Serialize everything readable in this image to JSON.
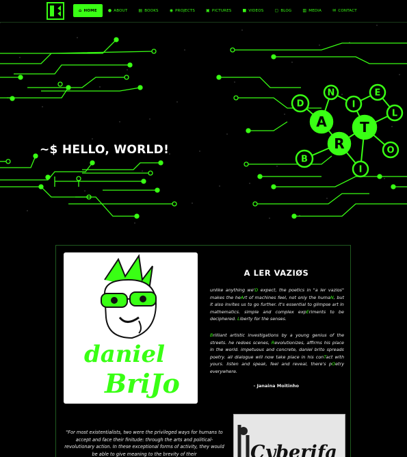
{
  "nav": {
    "items": [
      {
        "label": "HOME",
        "icon": "home-icon"
      },
      {
        "label": "ABOUT",
        "icon": "user-icon"
      },
      {
        "label": "BOOKS",
        "icon": "book-icon"
      },
      {
        "label": "PROJECTS",
        "icon": "lightbulb-icon"
      },
      {
        "label": "PICTURES",
        "icon": "image-icon"
      },
      {
        "label": "VIDEOS",
        "icon": "video-icon"
      },
      {
        "label": "BLOG",
        "icon": "blog-icon"
      },
      {
        "label": "MEDIA",
        "icon": "newspaper-icon"
      },
      {
        "label": "CONTACT",
        "icon": "envelope-icon"
      }
    ],
    "active": "HOME"
  },
  "hero": {
    "heading": "~$ HELLO, WORLD!",
    "circuit_letters": [
      "N",
      "E",
      "D",
      "I",
      "L",
      "A",
      "T",
      "R",
      "O",
      "B",
      "I"
    ]
  },
  "about": {
    "title": "A LER VAZIØS",
    "paragraph1": "unlike anything we'D expect, the poetics in \"a ler vazios\" makes the heArt of machines feel, not only the humaN, but it also invites us to go further. it's essential to glimpse art in mathematics. simple and complex expEriments to be deciphered. Liberty for the senses.",
    "paragraph2": "Brilliant artistic investigations by a young genius of the streets. he redoes scenes, Revolutionizes, affirms his place in the world. impetuous and concrete, daniel brito spreads poetry. all dialogue will now take place in his conTact with yours. listen and speak, feel and reveal, there's pOetry everywhere.",
    "signature": "- Janaina Moitinho",
    "quote": "\"For most existentialists, two were the privileged ways for humans to accept and face their finitude: through the arts and political-revolutionary action. In these exceptional forms of activity, they would be able to give meaning to the brevity of their",
    "poster_text": "Cyberifa"
  },
  "colors": {
    "accent": "#39ff14",
    "background": "#000000"
  }
}
